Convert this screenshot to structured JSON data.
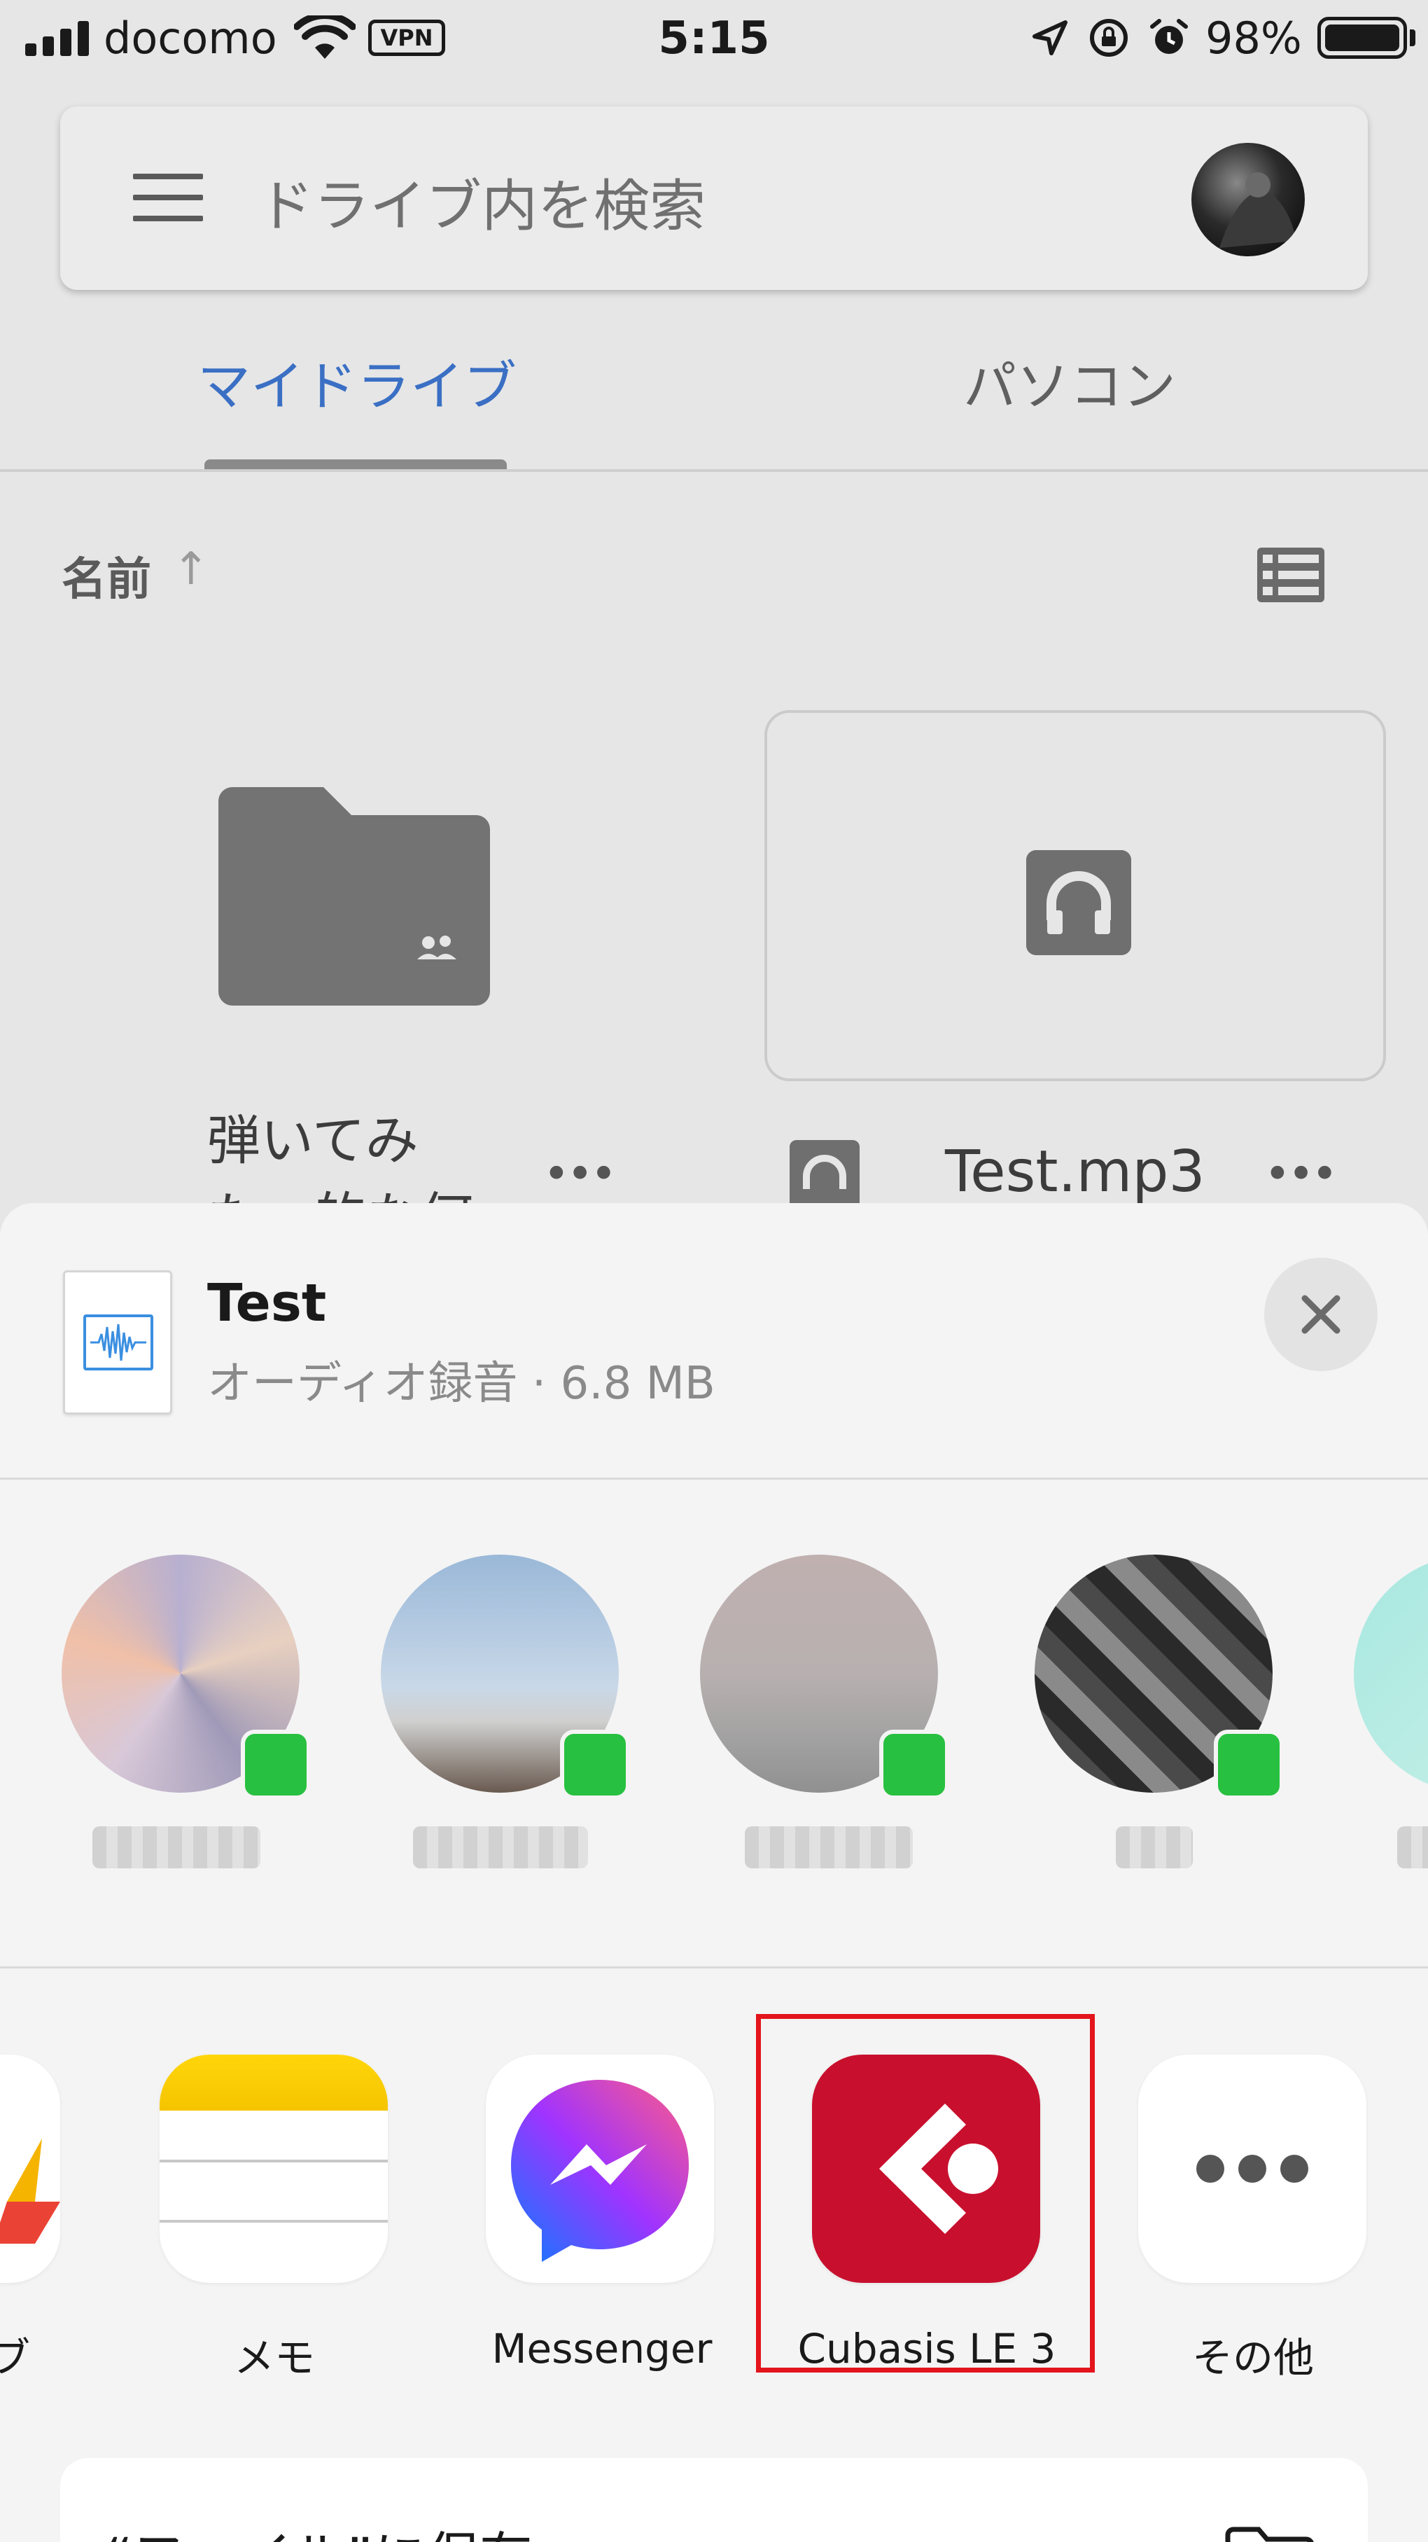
{
  "status_bar": {
    "carrier": "docomo",
    "vpn": "VPN",
    "time": "5:15",
    "battery": "98%"
  },
  "search": {
    "placeholder": "ドライブ内を検索"
  },
  "tabs": [
    {
      "label": "マイドライブ",
      "active": true
    },
    {
      "label": "パソコン",
      "active": false
    }
  ],
  "sort": {
    "label": "名前",
    "arrow": "↑"
  },
  "items": [
    {
      "type": "shared-folder",
      "name": "弾いてみた・的な何か"
    },
    {
      "type": "audio",
      "name": "Test.mp3"
    }
  ],
  "share_sheet": {
    "file_title": "Test",
    "file_subtitle": "オーディオ録音 · 6.8 MB",
    "apps": [
      {
        "label": "ブ"
      },
      {
        "label": "メモ"
      },
      {
        "label": "Messenger"
      },
      {
        "label": "Cubasis LE 3",
        "highlighted": true
      },
      {
        "label": "その他"
      }
    ],
    "save_to_files": "“ファイル”に保存"
  },
  "colors": {
    "accent_blue": "#3a6fc4",
    "highlight_red": "#e3141c",
    "cubasis_red": "#c8102e",
    "line_green": "#28c040"
  }
}
